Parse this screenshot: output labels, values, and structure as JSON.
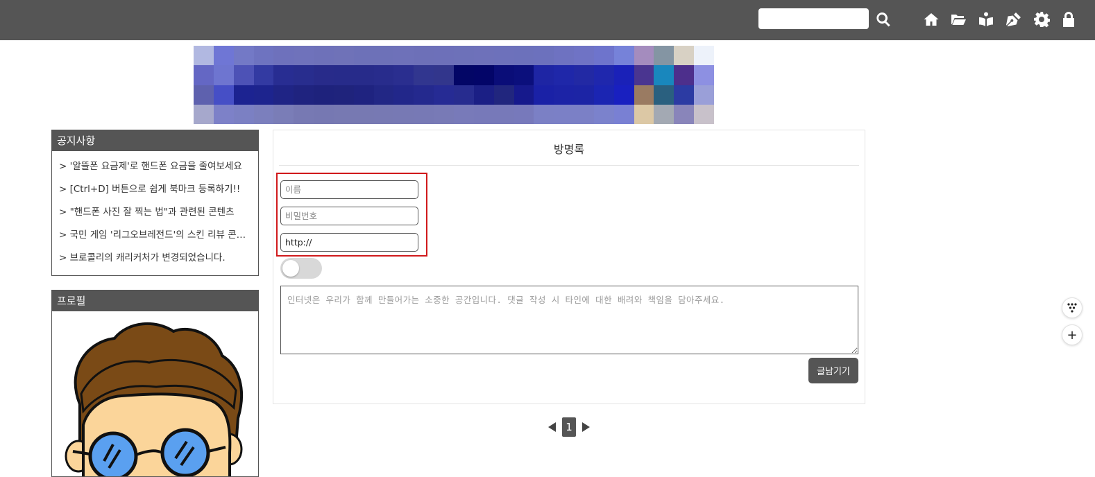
{
  "header": {
    "search": {
      "value": "",
      "placeholder": ""
    },
    "icons": [
      "search-icon",
      "home-icon",
      "folder-open-icon",
      "book-reader-icon",
      "pen-nib-icon",
      "gear-icon",
      "lock-icon"
    ],
    "bar_color": "#555555"
  },
  "banner": {
    "colors": [
      [
        "#b1b8e1",
        "#6f76d5",
        "#7379c6",
        "#6e73c0",
        "#6e71bc",
        "#6f72bb",
        "#6e71b9",
        "#6f72b8",
        "#6d71b8",
        "#6d71b8",
        "#6e71b9",
        "#6d70b8",
        "#6d70b9",
        "#6d71b9",
        "#6e71ba",
        "#6d71bb",
        "#6c71bb",
        "#6c71bd",
        "#6e72c1",
        "#6f73c5",
        "#6e74cc",
        "#7682d9",
        "#a48cbe",
        "#8495a3",
        "#d8d1c4",
        "#edf2fa"
      ],
      [
        "#6467c4",
        "#6e75d0",
        "#4d52b6",
        "#333aa2",
        "#282d92",
        "#282d8e",
        "#282b8a",
        "#272b8a",
        "#272b8a",
        "#282c8c",
        "#2a2e8f",
        "#31368f",
        "#32368c",
        "#030666",
        "#030568",
        "#0a0d78",
        "#0b0f7c",
        "#1e25a4",
        "#1f27a9",
        "#2229a4",
        "#1f27ad",
        "#1a21b8",
        "#4a3590",
        "#1987bd",
        "#4d2f8c",
        "#8d90e2"
      ],
      [
        "#5e61ae",
        "#464fc6",
        "#1c2391",
        "#1d248e",
        "#1f2485",
        "#1f237f",
        "#1e227c",
        "#1f237c",
        "#1f2380",
        "#222785",
        "#22278a",
        "#24298e",
        "#262b94",
        "#272c8f",
        "#1b1f85",
        "#21267e",
        "#16198c",
        "#1a21a6",
        "#1c23a6",
        "#1c24a5",
        "#1b25b2",
        "#1920c0",
        "#9a7b62",
        "#2a607f",
        "#2c3ba3",
        "#9a9fd8"
      ],
      [
        "#a6a8cc",
        "#7d81c8",
        "#7b80c3",
        "#7b7fbd",
        "#7a7db7",
        "#7779b3",
        "#7678b2",
        "#7779b2",
        "#7779b2",
        "#7779b3",
        "#7779b4",
        "#7779b5",
        "#787ab6",
        "#787ab9",
        "#7779b9",
        "#7779b9",
        "#7779bb",
        "#7b80c5",
        "#7b80c6",
        "#7b80c6",
        "#7b82cc",
        "#7980d3",
        "#dcc8a5",
        "#a3a9b3",
        "#8985ba",
        "#c8c1ca"
      ]
    ]
  },
  "notice": {
    "title": "공지사항",
    "items": [
      "> '알뜰폰 요금제'로 핸드폰 요금을 줄여보세요",
      "> [Ctrl+D] 버튼으로 쉽게 북마크 등록하기!!",
      "> \"핸드폰 사진 잘 찍는 법\"과 관련된 콘텐츠",
      "> 국민 게임 '리그오브레전드'의 스킨 리뷰 콘텐츠",
      "> 브로콜리의 캐리커처가 변경되었습니다."
    ]
  },
  "profile": {
    "title": "프로필"
  },
  "guestbook": {
    "title": "방명록",
    "name": {
      "value": "",
      "placeholder": "이름"
    },
    "password": {
      "value": "",
      "placeholder": "비밀번호"
    },
    "homepage": {
      "value": "http://",
      "placeholder": ""
    },
    "secret_toggle_on": false,
    "comment": {
      "value": "",
      "placeholder": "인터넷은 우리가 함께 만들어가는 소중한 공간입니다. 댓글 작성 시 타인에 대한 배려와 책임을 담아주세요."
    },
    "submit_label": "글남기기",
    "highlight_color": "#d0191b"
  },
  "pagination": {
    "current": "1",
    "prev_icon": "caret-left-icon",
    "next_icon": "caret-right-icon"
  },
  "floating": {
    "menu_icon": "dots-grid-icon",
    "plus_label": "+"
  }
}
